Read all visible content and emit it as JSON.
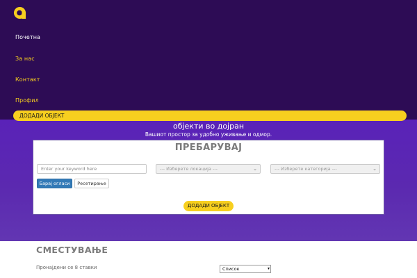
{
  "colors": {
    "header_bg": "#2d0c55",
    "accent": "#f7cf1f",
    "hero_bg": "#5a22b8",
    "nav_active": "#ffffff",
    "nav_link": "#f7cf1f"
  },
  "header": {
    "logo_icon": "brand-logo-icon",
    "nav": [
      {
        "label": "Почетна"
      },
      {
        "label": "За нас"
      },
      {
        "label": "Контакт"
      },
      {
        "label": "Профил"
      }
    ],
    "add_object_label": "ДОДАДИ ОБЈЕКТ"
  },
  "hero": {
    "title": "објекти во дојран",
    "subtitle": "Вашиот простор за удобно уживање и одмор."
  },
  "search": {
    "title": "ПРЕБАРУВАЈ",
    "keyword_placeholder": "Enter your keyword here",
    "location_placeholder": "--- Изберете локација ---",
    "category_placeholder": "--- Изберете категорија ---",
    "search_button": "Барај огласи",
    "reset_button": "Ресетирање",
    "add_object_button": "ДОДАДИ ОБЈЕКТ"
  },
  "listing": {
    "section_title": "СМЕСТУВАЊЕ",
    "found_text": "Пронајдени се 8 ставки",
    "view_mode": "Список"
  }
}
